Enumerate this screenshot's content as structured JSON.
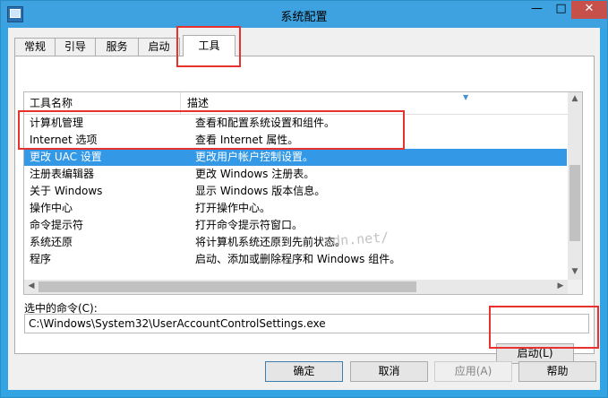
{
  "window": {
    "title": "系统配置",
    "controls": {
      "minimize": "—",
      "maximize": "□",
      "close": "✕"
    }
  },
  "tabs": [
    {
      "label": "常规"
    },
    {
      "label": "引导"
    },
    {
      "label": "服务"
    },
    {
      "label": "启动"
    },
    {
      "label": "工具"
    }
  ],
  "active_tab": "工具",
  "list": {
    "columns": [
      "工具名称",
      "描述"
    ],
    "rows": [
      {
        "name": "计算机管理",
        "desc": "查看和配置系统设置和组件。"
      },
      {
        "name": "Internet 选项",
        "desc": "查看 Internet 属性。"
      },
      {
        "name": "更改 UAC 设置",
        "desc": "更改用户帐户控制设置。"
      },
      {
        "name": "注册表编辑器",
        "desc": "更改 Windows 注册表。"
      },
      {
        "name": "关于 Windows",
        "desc": "显示 Windows 版本信息。"
      },
      {
        "name": "操作中心",
        "desc": "打开操作中心。"
      },
      {
        "name": "命令提示符",
        "desc": "打开命令提示符窗口。"
      },
      {
        "name": "系统还原",
        "desc": "将计算机系统还原到先前状态。"
      },
      {
        "name": "程序",
        "desc": "启动、添加或删除程序和 Windows 组件。"
      }
    ],
    "selected_row": "更改 UAC 设置"
  },
  "command": {
    "label": "选中的命令(C):",
    "value": "C:\\Windows\\System32\\UserAccountControlSettings.exe"
  },
  "buttons": {
    "launch": "启动(L)",
    "ok": "确定",
    "cancel": "取消",
    "apply": "应用(A)",
    "help": "帮助"
  },
  "watermark": "sdn.net/",
  "colors": {
    "titlebar": "#3da2df",
    "selection": "#3398e6",
    "annotation_red": "#e8322f"
  }
}
